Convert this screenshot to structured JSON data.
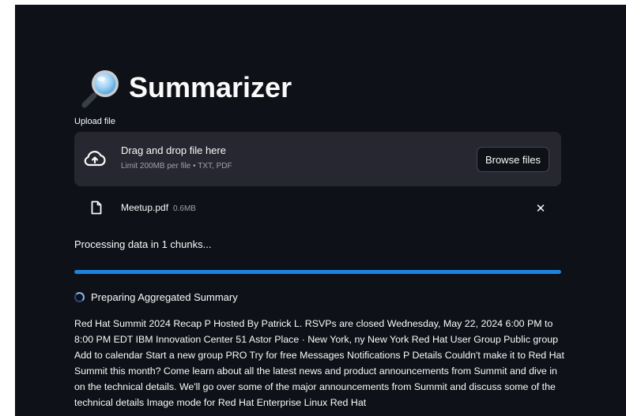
{
  "app": {
    "title": "Summarizer",
    "title_icon": "magnifying-glass-icon"
  },
  "uploader": {
    "label": "Upload file",
    "drop_text": "Drag and drop file here",
    "limit_text": "Limit 200MB per file • TXT, PDF",
    "browse_label": "Browse files",
    "icon": "cloud-upload-icon"
  },
  "file": {
    "name": "Meetup.pdf",
    "size": "0.6MB",
    "icon": "file-icon",
    "remove_label": "✕"
  },
  "processing": {
    "status": "Processing data in 1 chunks...",
    "progress": 1.0,
    "spinner_text": "Preparing Aggregated Summary"
  },
  "summary_text": "Red Hat Summit 2024 Recap P Hosted By Patrick L. RSVPs are closed Wednesday, May 22, 2024 6:00 PM to 8:00 PM EDT IBM Innovation Center 51 Astor Place · New York, ny New York Red Hat User Group Public group Add to calendar Start a new group PRO Try for free Messages Notifications P Details Couldn't make it to Red Hat Summit this month? Come learn about all the latest news and product announcements from Summit and dive in on the technical details. We'll go over some of the major announcements from Summit and discuss some of the technical details Image mode for Red Hat Enterprise Linux Red Hat",
  "colors": {
    "background": "#0e1117",
    "surface": "#262730",
    "text": "#fafafa",
    "muted": "#9ea2ab",
    "accent": "#1c83e1"
  }
}
